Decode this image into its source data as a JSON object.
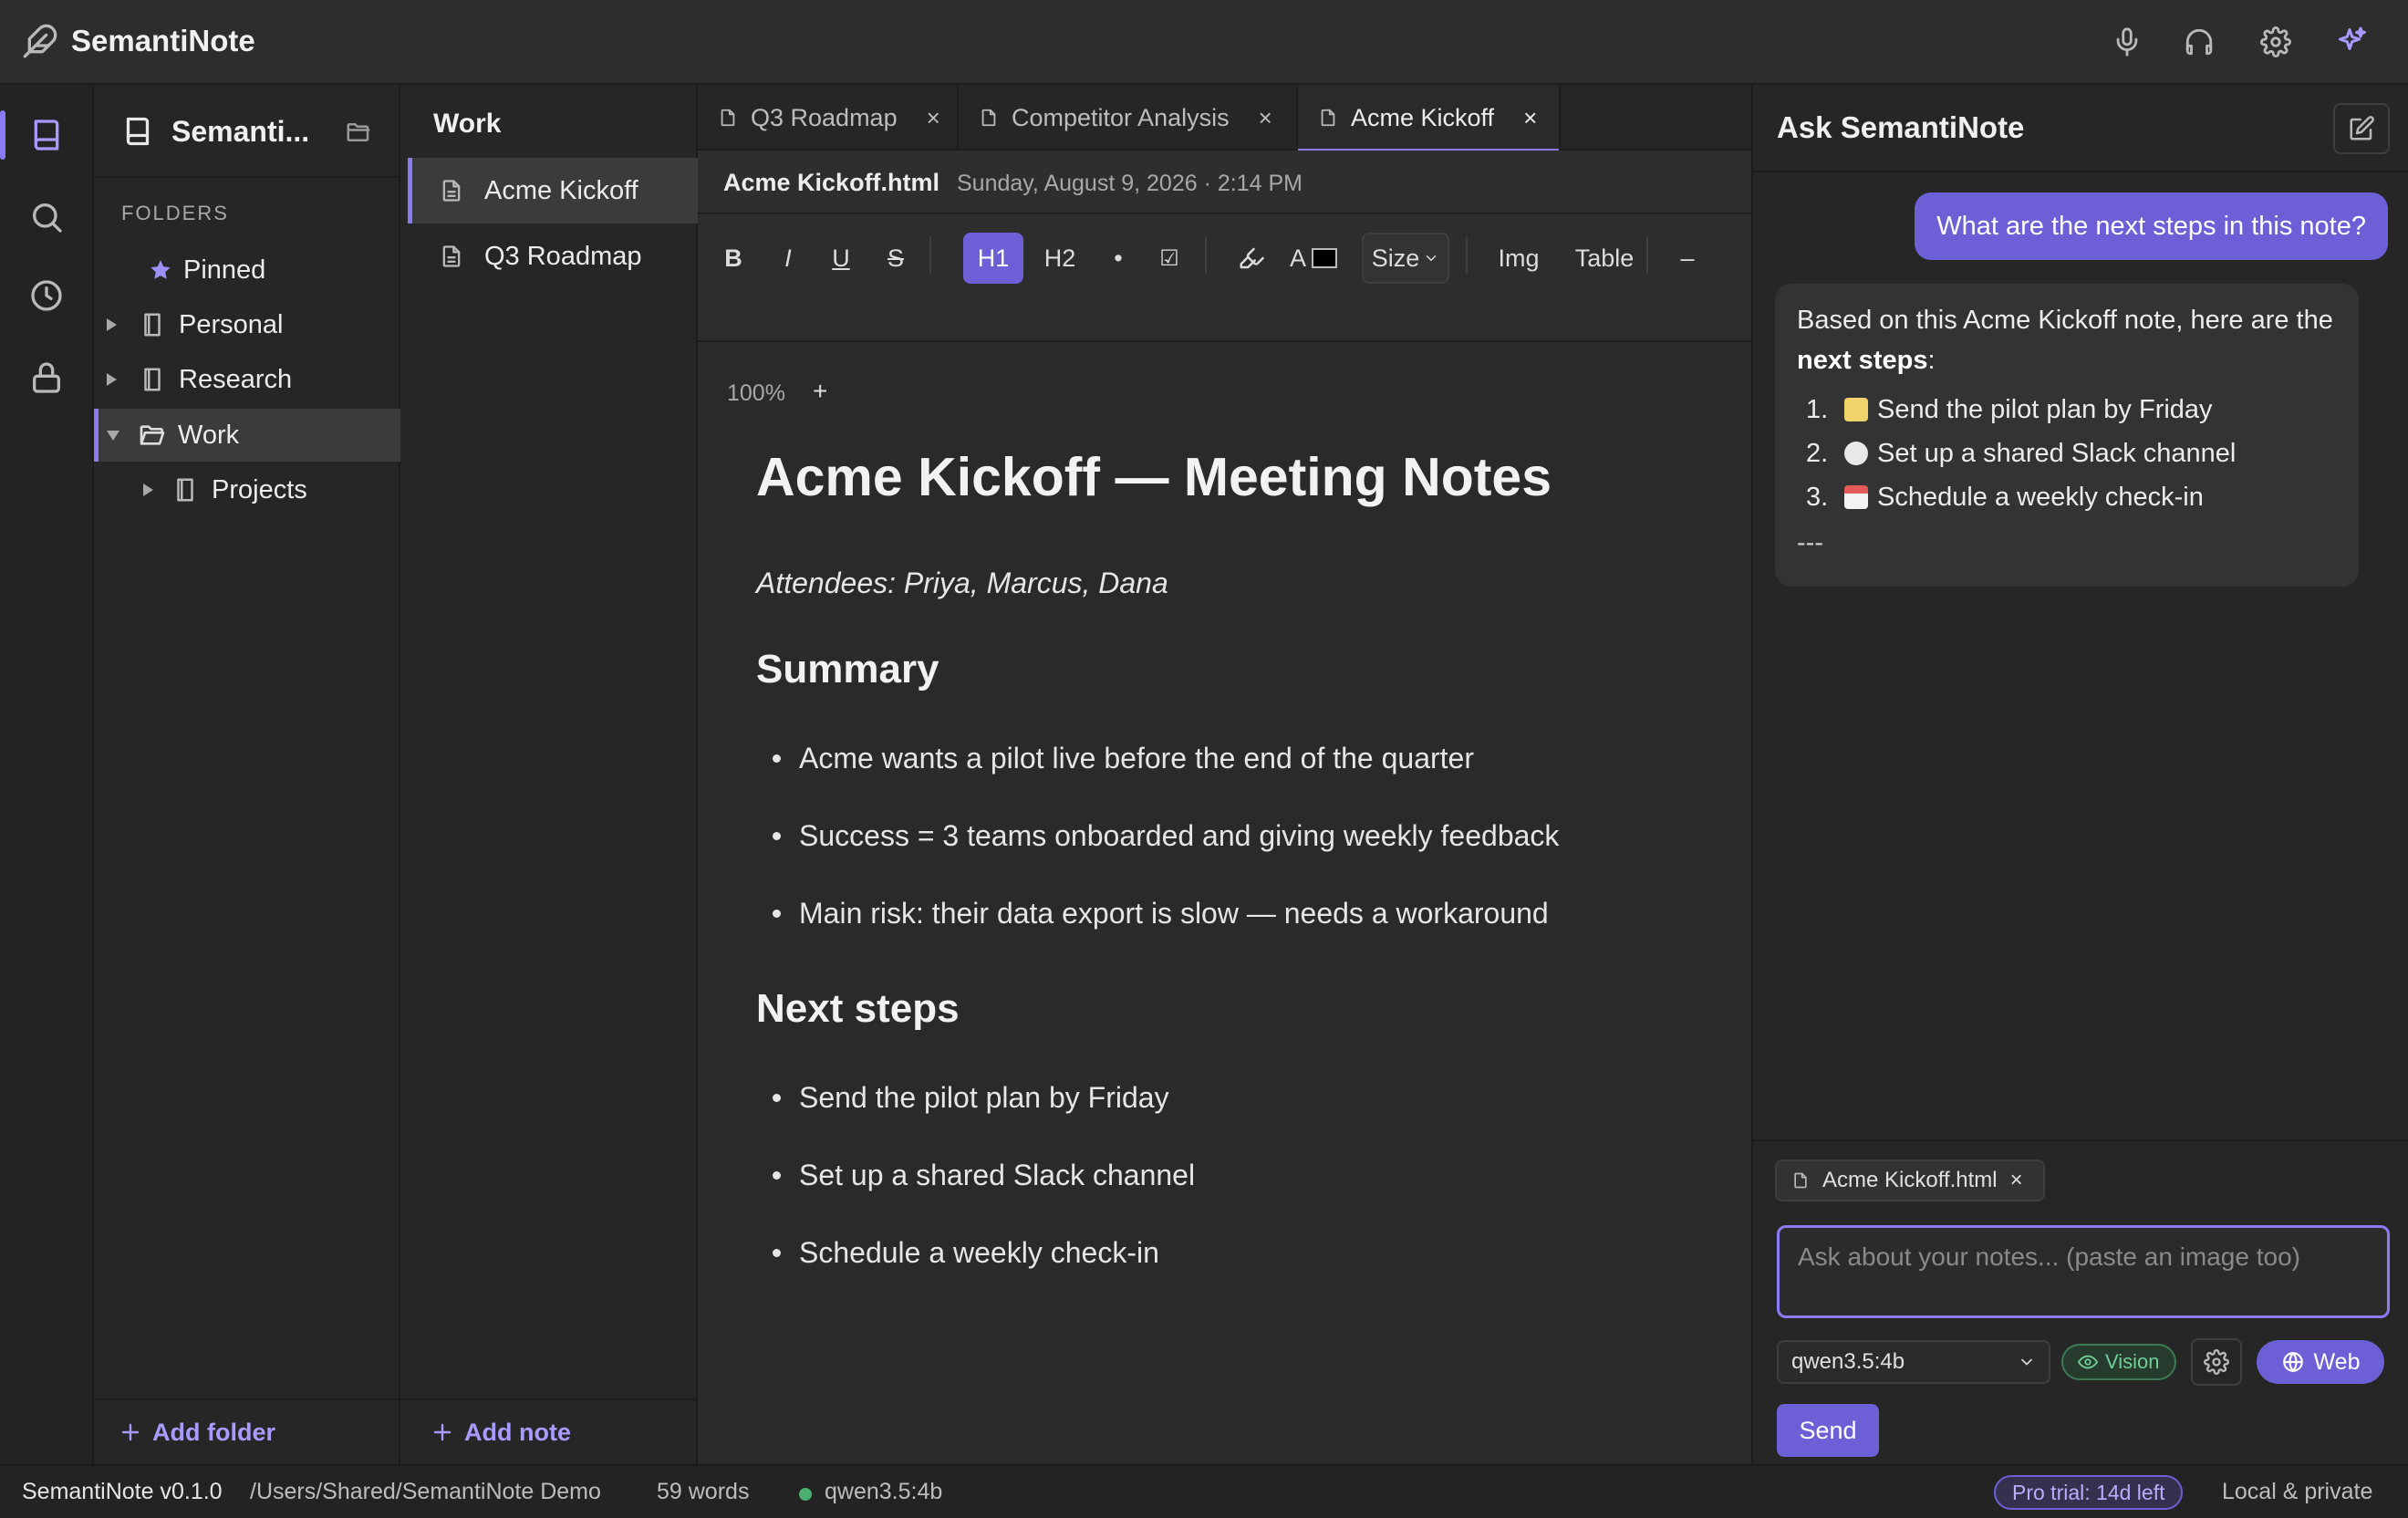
{
  "app": {
    "title": "SemantiNote",
    "accent": "#8b7cf6",
    "accent_strong": "#6d5fd6"
  },
  "topbar": {
    "icons": [
      "microphone-icon",
      "headphones-icon",
      "gear-icon",
      "sparkles-icon"
    ]
  },
  "rail": {
    "items": [
      "notebook-icon",
      "search-icon",
      "clock-icon",
      "lock-icon"
    ]
  },
  "folders": {
    "vault_name": "Semanti...",
    "section_label": "FOLDERS",
    "items": [
      {
        "label": "Pinned",
        "icon": "star-icon"
      },
      {
        "label": "Personal",
        "icon": "notebook-icon"
      },
      {
        "label": "Research",
        "icon": "notebook-icon"
      },
      {
        "label": "Work",
        "icon": "folder-open-icon",
        "selected": true
      },
      {
        "label": "Projects",
        "icon": "notebook-icon"
      }
    ],
    "add_label": "Add folder"
  },
  "notes": {
    "title": "Work",
    "items": [
      {
        "label": "Acme Kickoff",
        "selected": true
      },
      {
        "label": "Q3 Roadmap"
      }
    ],
    "add_label": "Add note"
  },
  "editor": {
    "tabs": [
      {
        "label": "Q3 Roadmap"
      },
      {
        "label": "Competitor Analysis"
      },
      {
        "label": "Acme Kickoff",
        "active": true
      }
    ],
    "tab_close": "×",
    "file_name": "Acme Kickoff.html",
    "file_date": "Sunday, August 9, 2026 · 2:14 PM",
    "toolbar": {
      "bold": "B",
      "italic": "I",
      "underline": "U",
      "strike": "S",
      "h1": "H1",
      "h2": "H2",
      "bullet": "•",
      "checkbox": "☑",
      "text_color": "A",
      "size": "Size",
      "img": "Img",
      "table": "Table",
      "zoom_out": "–",
      "zoom": "100%",
      "zoom_in": "+"
    },
    "doc": {
      "title": "Acme Kickoff — Meeting Notes",
      "attendees": "Attendees: Priya, Marcus, Dana",
      "summary_heading": "Summary",
      "summary_items": [
        "Acme wants a pilot live before the end of the quarter",
        "Success = 3 teams onboarded and giving weekly feedback",
        "Main risk: their data export is slow — needs a workaround"
      ],
      "next_heading": "Next steps",
      "next_items": [
        "Send the pilot plan by Friday",
        "Set up a shared Slack channel",
        "Schedule a weekly check-in"
      ]
    }
  },
  "assistant": {
    "title": "Ask SemantiNote",
    "user_message": "What are the next steps in this note?",
    "bot_intro_a": "Based on this Acme Kickoff note, here are the ",
    "bot_intro_bold": "next steps",
    "bot_intro_b": ":",
    "bot_steps": [
      {
        "num": "1.",
        "text": "Send the pilot plan by Friday",
        "emoji": "memo-emoji"
      },
      {
        "num": "2.",
        "text": "Set up a shared Slack channel",
        "emoji": "speech-bubble-emoji"
      },
      {
        "num": "3.",
        "text": "Schedule a weekly check-in",
        "emoji": "calendar-emoji"
      }
    ],
    "bot_hr": "---",
    "context_chip": "Acme Kickoff.html",
    "context_chip_close": "×",
    "input_placeholder": "Ask about your notes... (paste an image too)",
    "model": "qwen3.5:4b",
    "vision_label": "Vision",
    "web_label": "Web",
    "send_label": "Send"
  },
  "statusbar": {
    "version": "SemantiNote v0.1.0",
    "path": "/Users/Shared/SemantiNote Demo",
    "words": "59 words",
    "model": "qwen3.5:4b",
    "trial": "Pro trial: 14d left",
    "privacy": "Local & private"
  }
}
